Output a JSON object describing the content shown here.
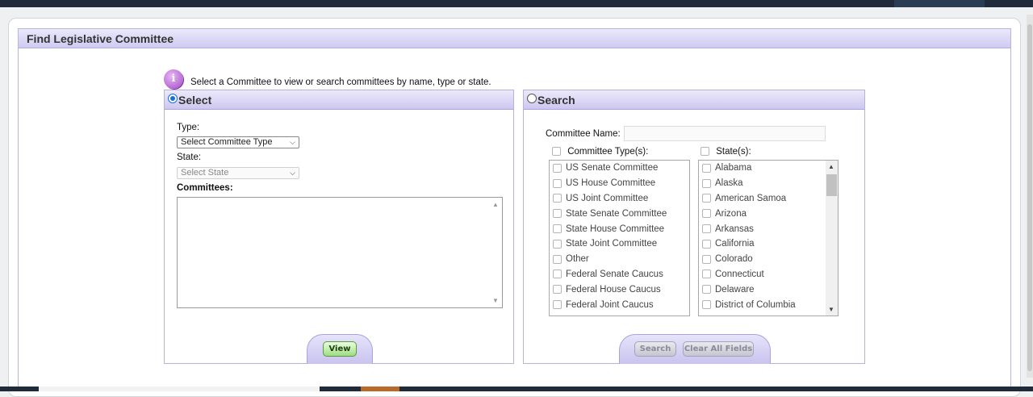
{
  "page": {
    "title": "Find Legislative Committee",
    "info_text": "Select a Committee to view or search committees by name, type or state."
  },
  "select_panel": {
    "title": "Select",
    "type_label": "Type:",
    "type_value": "Select Committee Type",
    "state_label": "State:",
    "state_value": "Select State",
    "committees_label": "Committees:",
    "view_button": "View"
  },
  "search_panel": {
    "title": "Search",
    "committee_name_label": "Committee Name:",
    "committee_name_value": "",
    "types_header": "Committee Type(s):",
    "states_header": "State(s):",
    "committee_types": [
      "US Senate Committee",
      "US House Committee",
      "US Joint Committee",
      "State Senate Committee",
      "State House Committee",
      "State Joint Committee",
      "Other",
      "Federal Senate Caucus",
      "Federal House Caucus",
      "Federal Joint Caucus"
    ],
    "states": [
      "Alabama",
      "Alaska",
      "American Samoa",
      "Arizona",
      "Arkansas",
      "California",
      "Colorado",
      "Connecticut",
      "Delaware",
      "District of Columbia"
    ],
    "search_button": "Search",
    "clear_button": "Clear All Fields"
  }
}
